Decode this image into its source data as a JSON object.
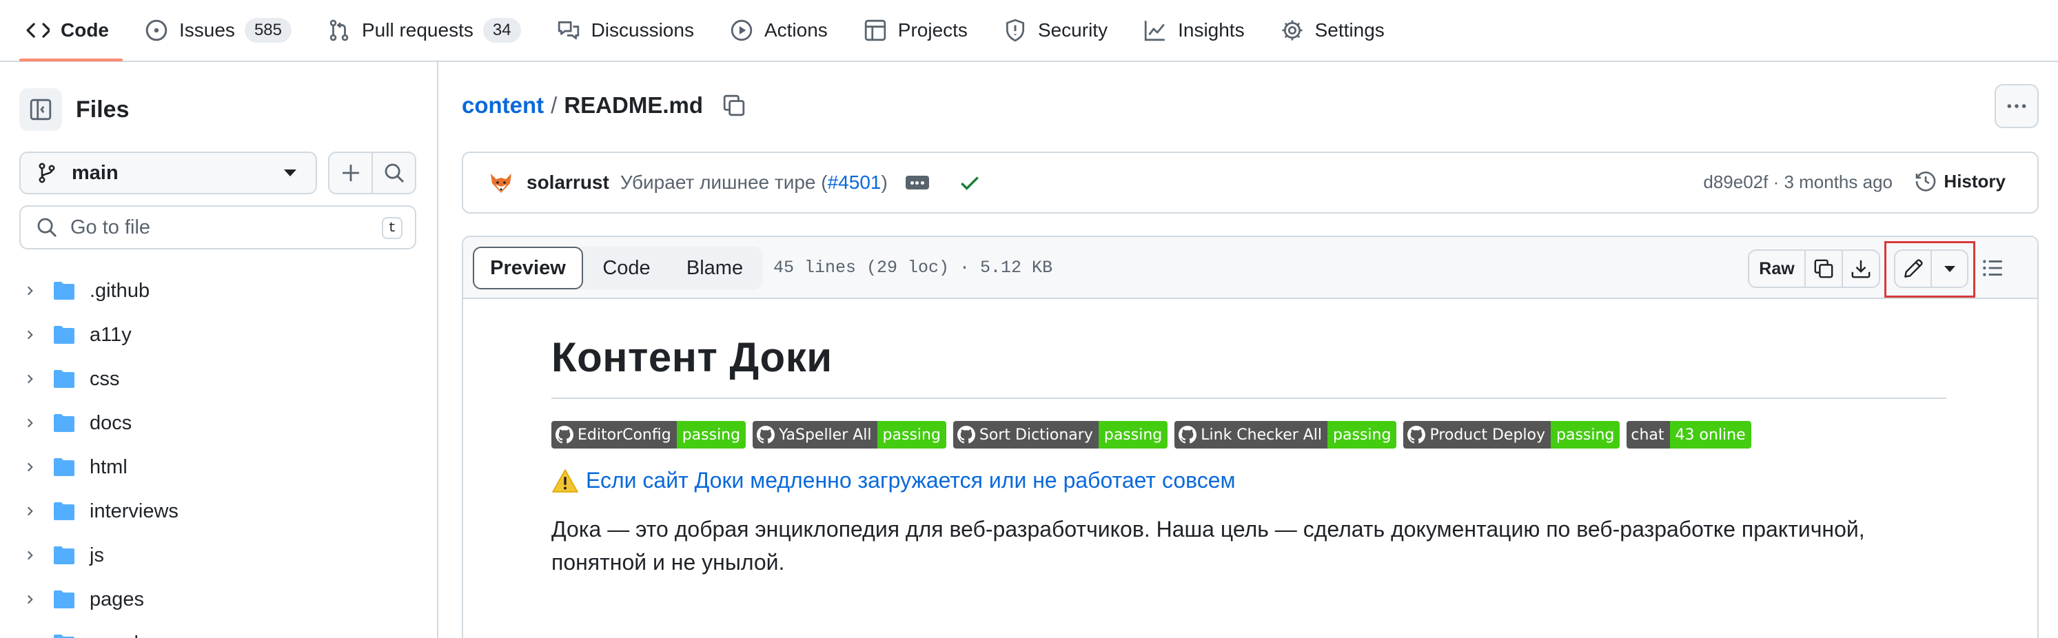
{
  "repo_nav": {
    "tabs": [
      {
        "label": "Code",
        "icon": "code-icon",
        "active": true
      },
      {
        "label": "Issues",
        "icon": "issue-opened-icon",
        "count": "585"
      },
      {
        "label": "Pull requests",
        "icon": "git-pull-request-icon",
        "count": "34"
      },
      {
        "label": "Discussions",
        "icon": "comment-discussion-icon"
      },
      {
        "label": "Actions",
        "icon": "play-icon"
      },
      {
        "label": "Projects",
        "icon": "table-icon"
      },
      {
        "label": "Security",
        "icon": "shield-icon"
      },
      {
        "label": "Insights",
        "icon": "graph-icon"
      },
      {
        "label": "Settings",
        "icon": "gear-icon"
      }
    ]
  },
  "sidebar": {
    "title": "Files",
    "branch": "main",
    "search_placeholder": "Go to file",
    "search_shortcut": "t",
    "tree": [
      ".github",
      "a11y",
      "css",
      "docs",
      "html",
      "interviews",
      "js",
      "pages",
      "people"
    ]
  },
  "main": {
    "breadcrumb": {
      "folder": "content",
      "separator": "/",
      "file": "README.md"
    },
    "commit": {
      "author": "solarrust",
      "message": "Убирает лишнее тире (",
      "pr": "#4501",
      "message_end": ")",
      "sha": "d89e02f",
      "age": "3 months ago",
      "meta": "d89e02f · 3 months ago",
      "history_label": "History"
    },
    "file_header": {
      "tabs": [
        "Preview",
        "Code",
        "Blame"
      ],
      "info": "45 lines (29 loc) · 5.12 KB",
      "raw_label": "Raw"
    },
    "readme": {
      "title": "Контент Доки",
      "badges": [
        {
          "label": "EditorConfig",
          "status": "passing",
          "github_icon": true,
          "color": "#4c1"
        },
        {
          "label": "YaSpeller All",
          "status": "passing",
          "github_icon": true,
          "color": "#4c1"
        },
        {
          "label": "Sort Dictionary",
          "status": "passing",
          "github_icon": true,
          "color": "#4c1"
        },
        {
          "label": "Link Checker All",
          "status": "passing",
          "github_icon": true,
          "color": "#4c1"
        },
        {
          "label": "Product Deploy",
          "status": "passing",
          "github_icon": true,
          "color": "#4c1"
        },
        {
          "label": "chat",
          "status": "43 online",
          "github_icon": false,
          "color": "#4c1"
        }
      ],
      "warning_link": "Если сайт Доки медленно загружается или не работает совсем",
      "paragraph_line1": "Дока — это добрая энциклопедия для веб-разработчиков. Наша цель — сделать документацию по веб-разработке практичной,",
      "paragraph_line2": "понятной и не унылой."
    }
  },
  "colors": {
    "accent_link": "#0969da",
    "active_tab_underline": "#fd8c73",
    "highlight_box": "#d73a3a",
    "badge_passing": "#4c1",
    "success_check": "#1a7f37"
  }
}
